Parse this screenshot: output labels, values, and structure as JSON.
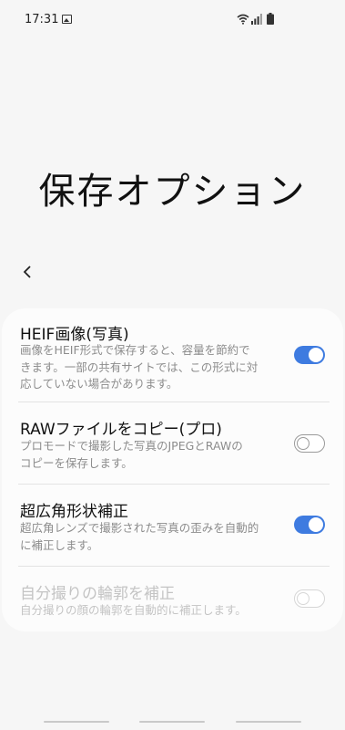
{
  "status_bar": {
    "time": "17:31",
    "icons": [
      "gallery-icon",
      "wifi-icon",
      "signal-icon",
      "battery-icon"
    ]
  },
  "page": {
    "title": "保存オプション",
    "back_icon": "‹"
  },
  "settings": [
    {
      "title": "HEIF画像(写真)",
      "description": "画像をHEIF形式で保存すると、容量を節約で\nきます。一部の共有サイトでは、この形式に対\n応していない場合があります。",
      "enabled": true,
      "available": true
    },
    {
      "title": "RAWファイルをコピー(プロ)",
      "description": "プロモードで撮影した写真のJPEGとRAWの\nコピーを保存します。",
      "enabled": false,
      "available": true
    },
    {
      "title": "超広角形状補正",
      "description": "超広角レンズで撮影された写真の歪みを自動的\nに補正します。",
      "enabled": true,
      "available": true
    },
    {
      "title": "自分撮りの輪郭を補正",
      "description": "自分撮りの顔の輪郭を自動的に補正します。",
      "enabled": false,
      "available": false
    }
  ],
  "colors": {
    "accent": "#3e7be0",
    "background": "#f6f6f6",
    "card": "#fcfcfc"
  }
}
